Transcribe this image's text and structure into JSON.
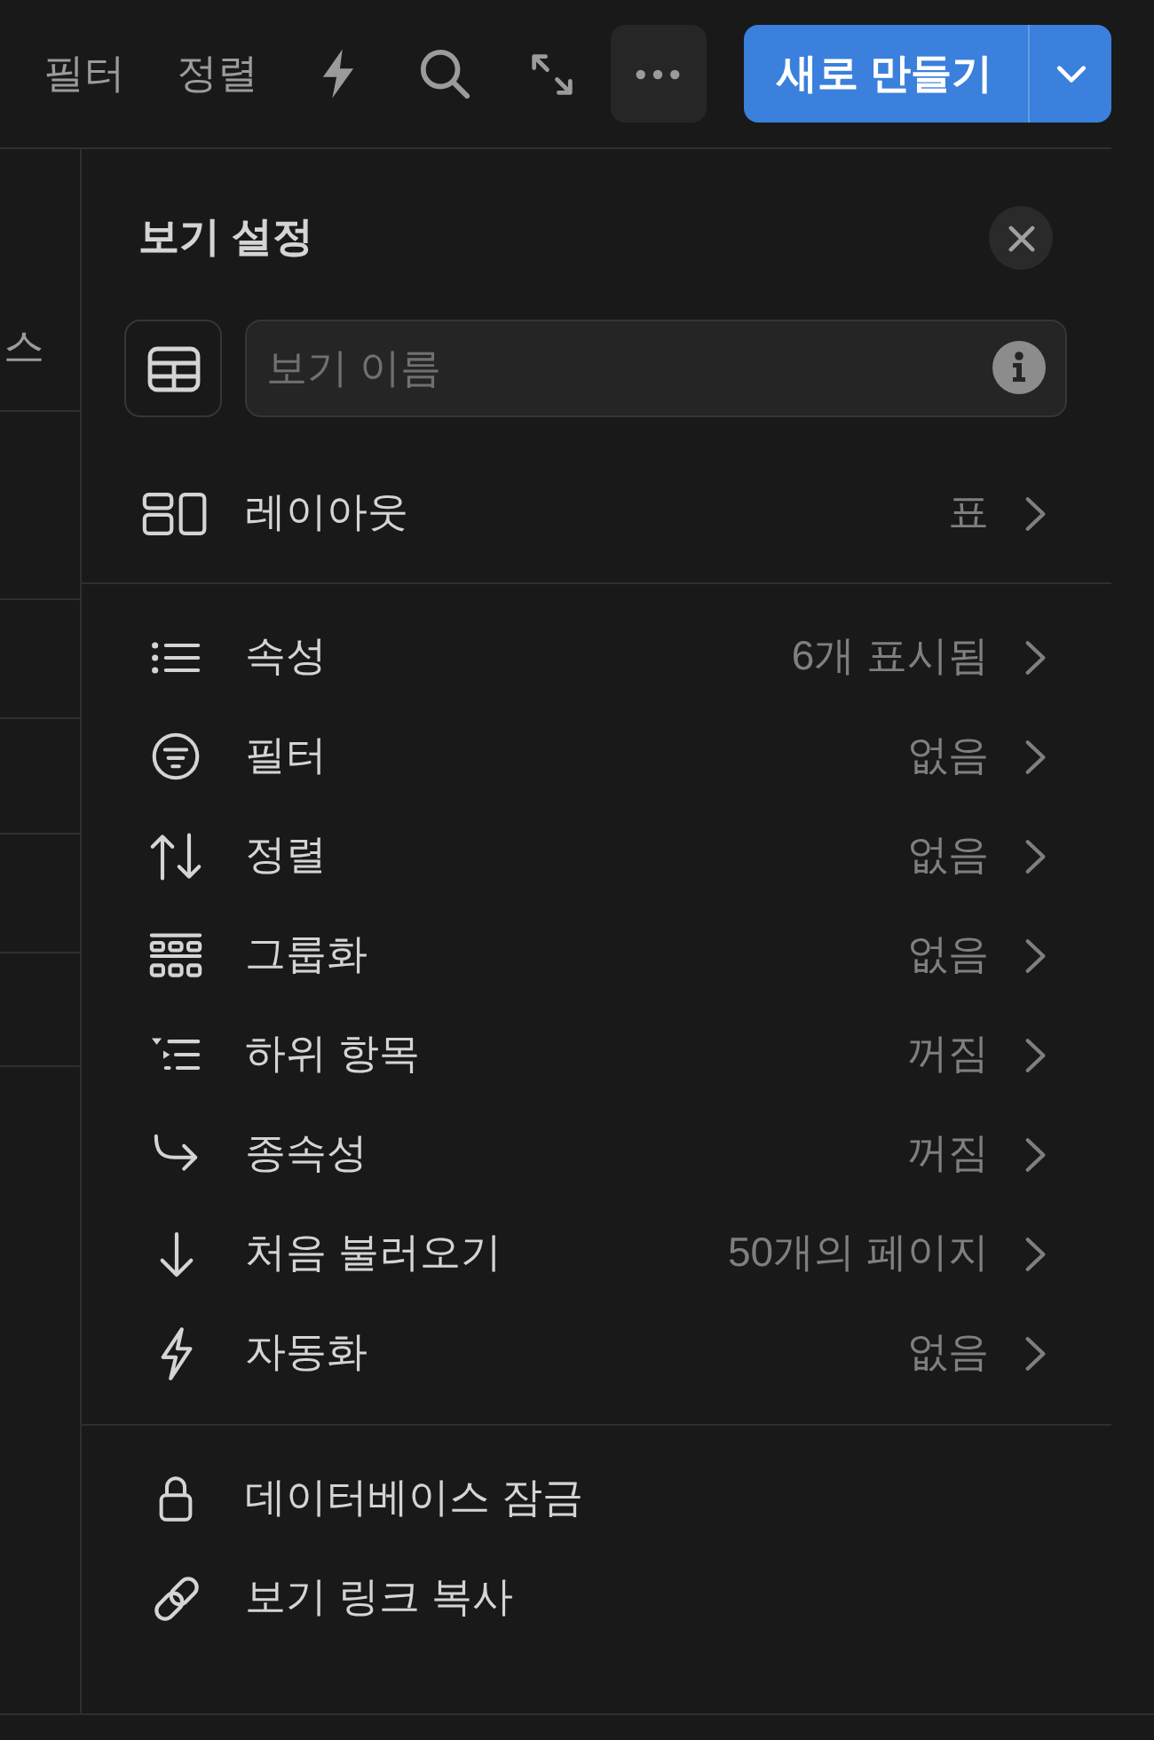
{
  "toolbar": {
    "text_buttons": [
      {
        "label": "필터"
      },
      {
        "label": "정렬"
      }
    ],
    "more_button": {
      "active": true
    },
    "new_button": {
      "label": "새로 만들기"
    }
  },
  "table": {
    "header_fragment": "스"
  },
  "view_settings": {
    "title": "보기 설정",
    "name_field": {
      "placeholder": "보기 이름"
    },
    "sections": [
      {
        "items": [
          {
            "label": "레이아웃",
            "value": "표"
          }
        ]
      },
      {
        "items": [
          {
            "label": "속성",
            "value": "6개 표시됨"
          },
          {
            "label": "필터",
            "value": "없음"
          },
          {
            "label": "정렬",
            "value": "없음"
          },
          {
            "label": "그룹화",
            "value": "없음"
          },
          {
            "label": "하위 항목",
            "value": "꺼짐"
          },
          {
            "label": "종속성",
            "value": "꺼짐"
          },
          {
            "label": "처음 불러오기",
            "value": "50개의 페이지"
          },
          {
            "label": "자동화",
            "value": "없음"
          }
        ]
      },
      {
        "items": [
          {
            "label": "데이터베이스 잠금"
          },
          {
            "label": "보기 링크 복사"
          }
        ]
      }
    ]
  }
}
